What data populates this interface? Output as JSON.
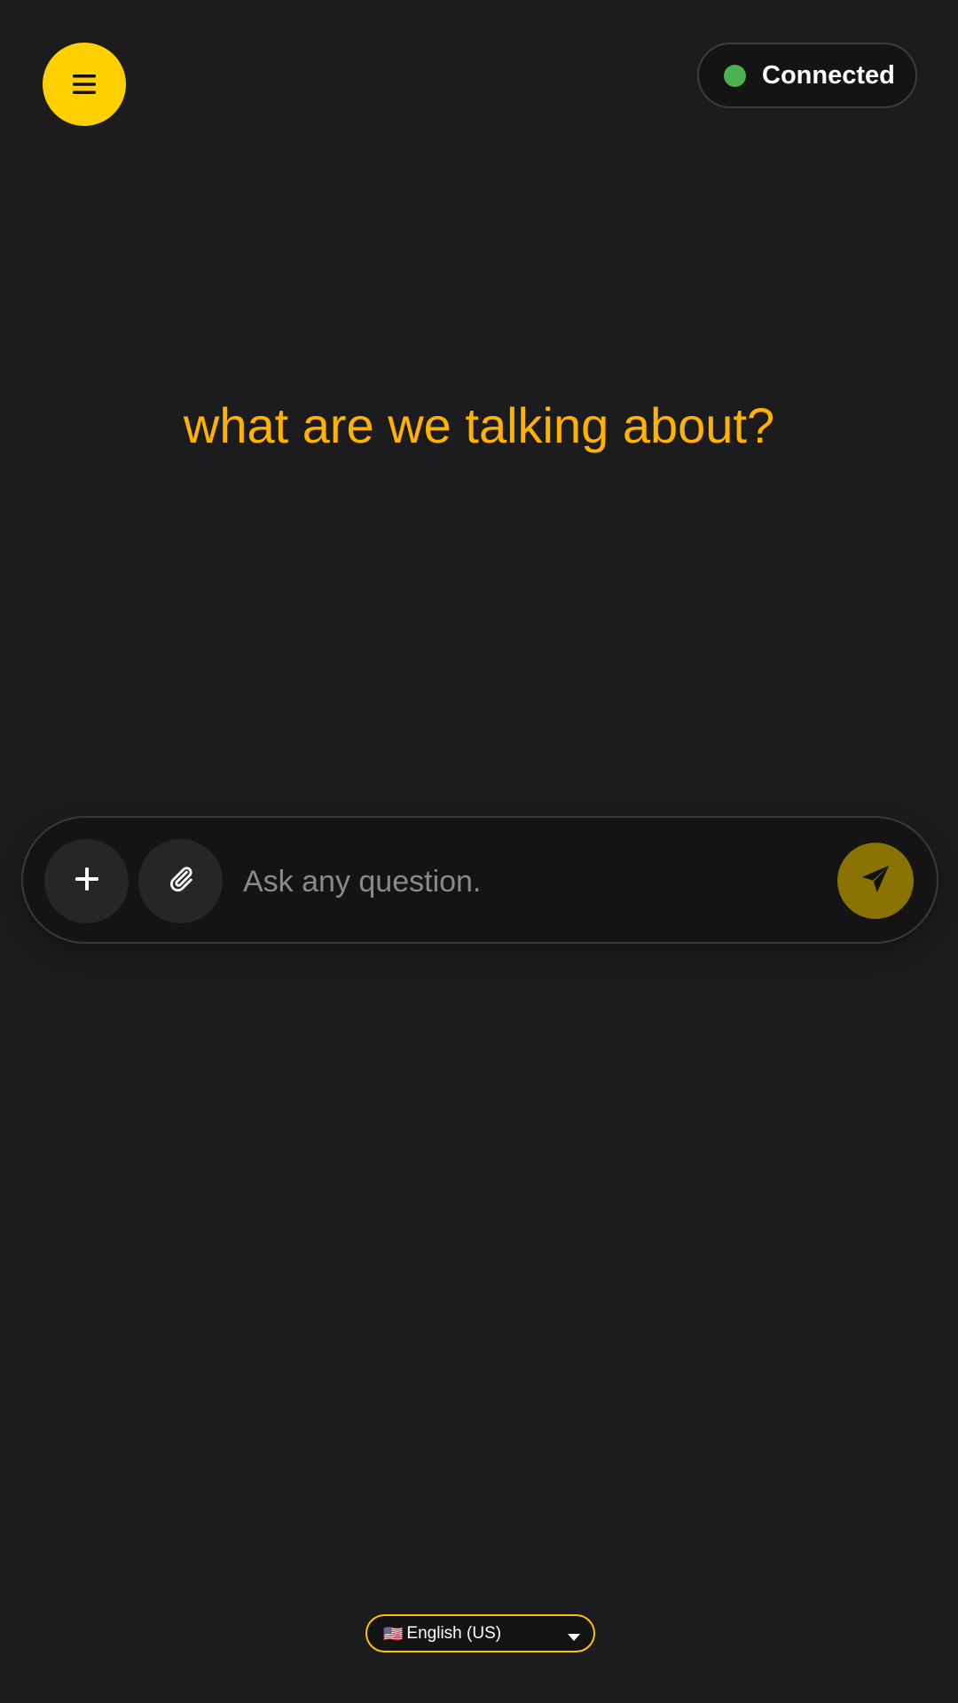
{
  "header": {
    "menu_icon": "hamburger-menu-icon",
    "status": {
      "label": "Connected",
      "dot_color": "#4caf50"
    }
  },
  "main": {
    "headline": "what are we talking about?"
  },
  "composer": {
    "add_icon": "plus-icon",
    "attach_icon": "paperclip-icon",
    "placeholder": "Ask any question.",
    "value": "",
    "send_icon": "paper-plane-icon"
  },
  "footer": {
    "language": {
      "flag": "🇺🇸",
      "selected": "English (US)",
      "caret_icon": "caret-down-icon"
    }
  },
  "colors": {
    "accent": "#ffd000",
    "headline": "#ffb300",
    "background": "#1c1c1e",
    "send_button": "#8a7300"
  }
}
